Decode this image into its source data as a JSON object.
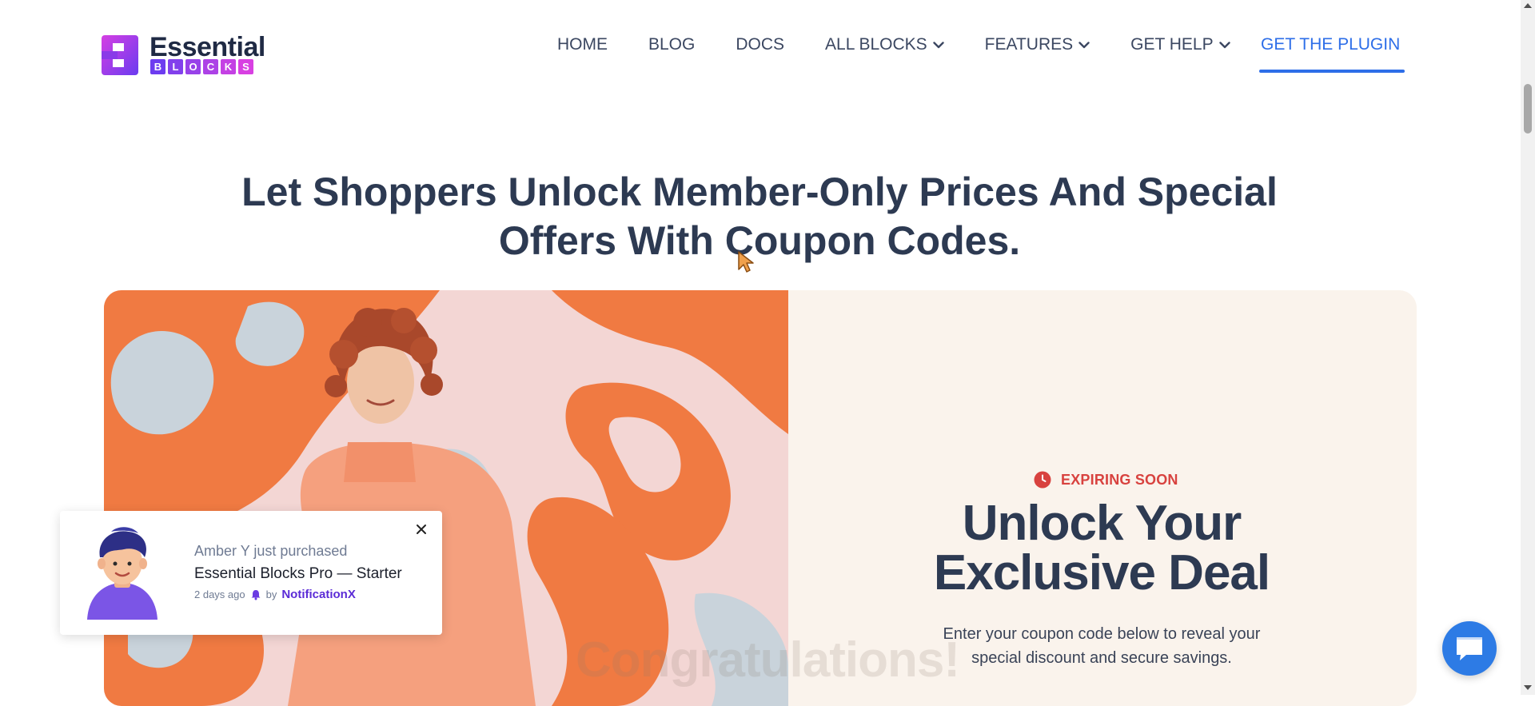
{
  "brand": {
    "name": "Essential",
    "sub_letters": [
      "B",
      "L",
      "O",
      "C",
      "K",
      "S"
    ]
  },
  "nav": {
    "home": "HOME",
    "blog": "BLOG",
    "docs": "DOCS",
    "all_blocks": "ALL BLOCKS",
    "features": "FEATURES",
    "get_help": "GET HELP",
    "cta": "GET THE PLUGIN"
  },
  "headline": {
    "line1": "Let Shoppers Unlock Member-Only Prices And Special",
    "line2": "Offers With Coupon Codes."
  },
  "hero": {
    "badge": "EXPIRING SOON",
    "title_line1": "Unlock Your",
    "title_line2": "Exclusive Deal",
    "desc_line1": "Enter your coupon code below to reveal your",
    "desc_line2": "special discount and secure savings.",
    "faded_text": "Congratulations!"
  },
  "notification": {
    "line1": "Amber Y just purchased",
    "line2": "Essential Blocks Pro — Starter",
    "time": "2 days ago",
    "by": "by",
    "brand": "NotificationX"
  },
  "colors": {
    "accent": "#2d6ee8",
    "heading": "#2d3a52",
    "badge_red": "#d8423f",
    "panel_bg": "#faf3ec",
    "hero_orange": "#f07a42",
    "notification_brand": "#5b2bd6"
  },
  "icons": {
    "dropdown": "chevron-down-icon",
    "close": "close-icon",
    "clock": "clock-icon",
    "chat": "chat-icon"
  }
}
